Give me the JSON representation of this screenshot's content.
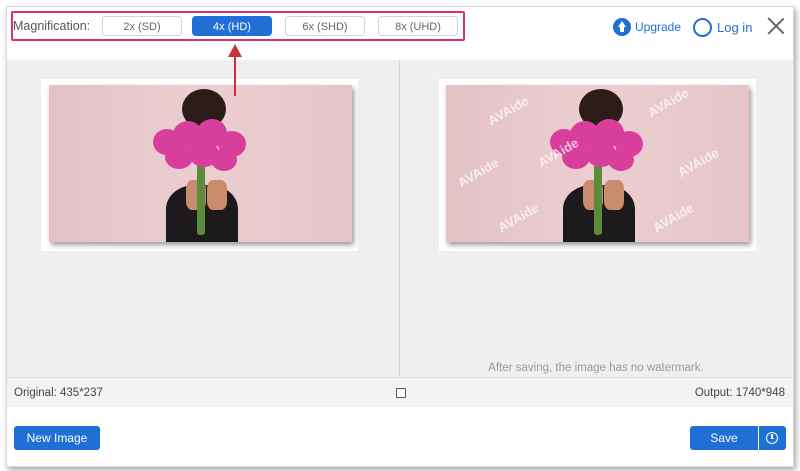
{
  "header": {
    "magnification_label": "Magnification:",
    "options": [
      {
        "label": "2x (SD)",
        "selected": false
      },
      {
        "label": "4x (HD)",
        "selected": true
      },
      {
        "label": "6x (SHD)",
        "selected": false
      },
      {
        "label": "8x (UHD)",
        "selected": false
      }
    ],
    "upgrade_label": "Upgrade",
    "login_label": "Log in",
    "highlight_color": "#d4317a",
    "arrow_color": "#c8303a"
  },
  "preview": {
    "watermark_text": "AVAide",
    "no_watermark_note": "After saving, the image has no watermark."
  },
  "infobar": {
    "original": "Original: 435*237",
    "output": "Output: 1740*948"
  },
  "actions": {
    "new_image": "New Image",
    "save": "Save"
  },
  "colors": {
    "accent": "#1f6fd6",
    "photo_background": "#e9c9cd",
    "flowers": "#d83f9c"
  }
}
